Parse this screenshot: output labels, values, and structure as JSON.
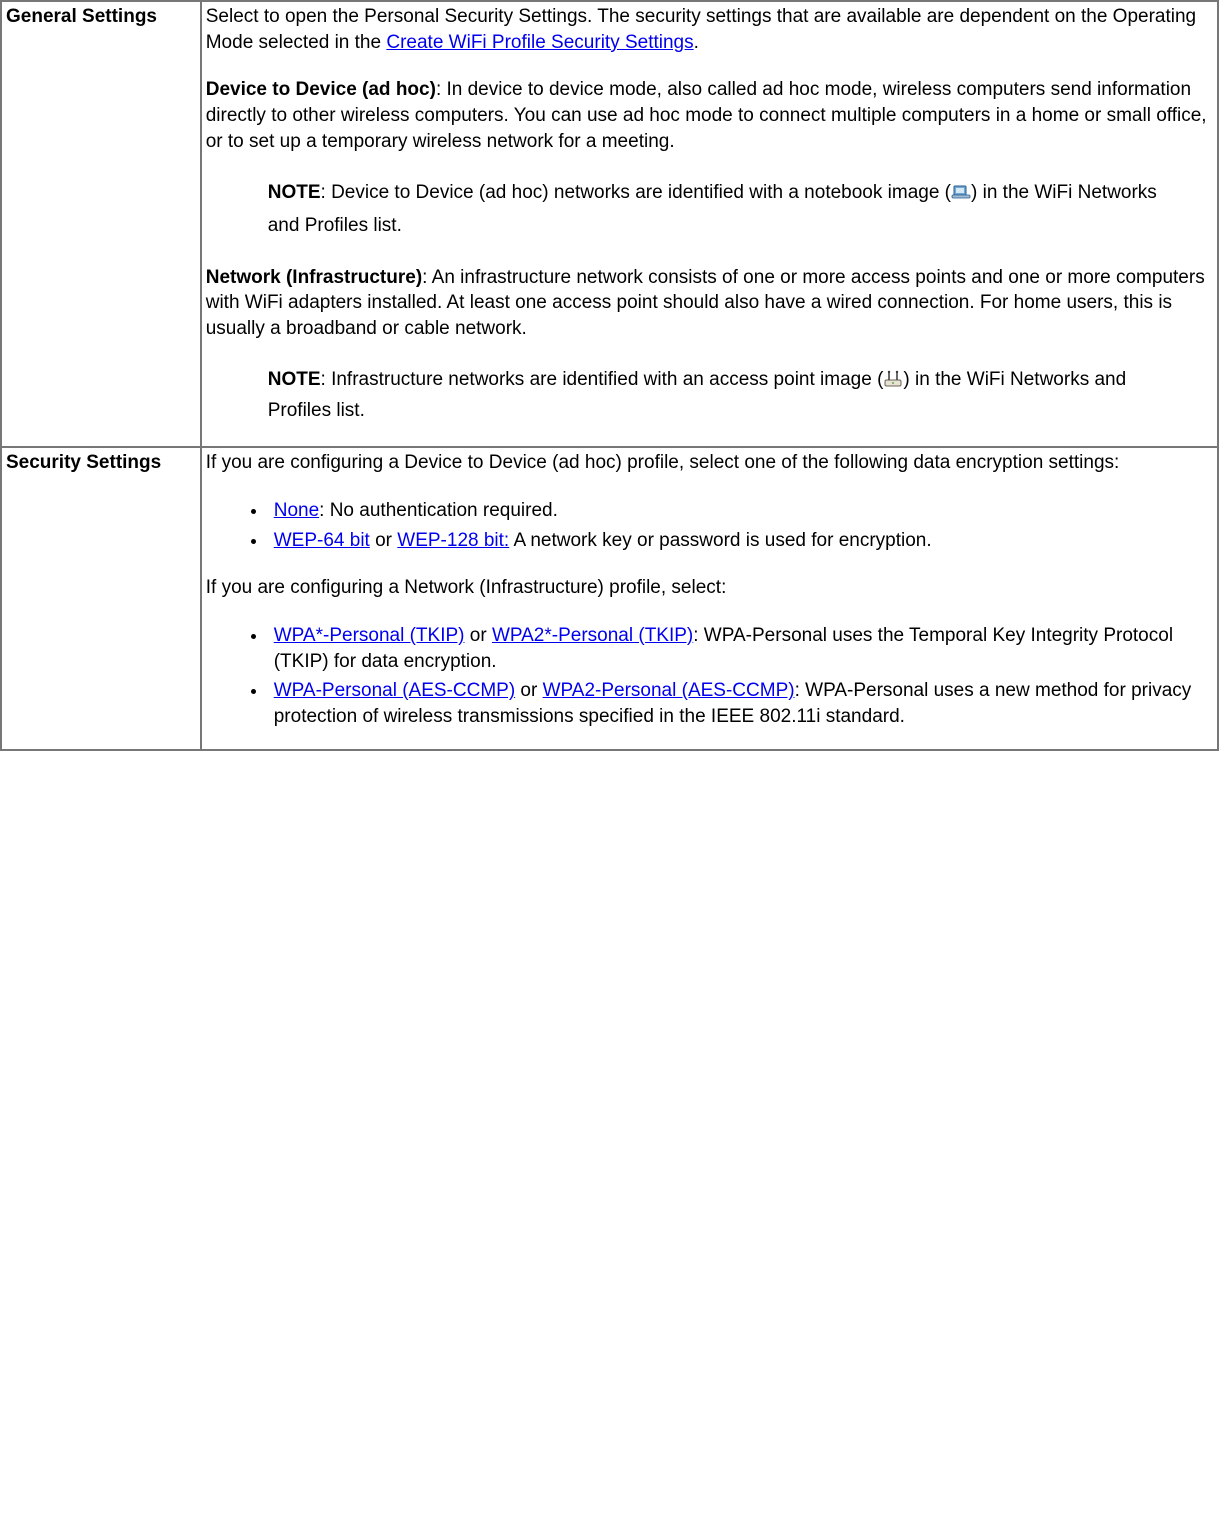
{
  "rows": {
    "general": {
      "label": "General Settings",
      "intro_pre": "Select to open the Personal Security Settings. The security settings that are available are dependent on the Operating Mode selected in the ",
      "intro_link": "Create WiFi Profile Security Settings",
      "intro_post": ".",
      "adhoc_heading": "Device to Device (ad hoc)",
      "adhoc_body": ": In device to device mode, also called ad hoc mode, wireless computers send information directly to other wireless computers. You can use ad hoc mode to connect multiple computers in a home or small office, or to set up a temporary wireless network for a meeting.",
      "adhoc_note_label": "NOTE",
      "adhoc_note_pre": ": Device to Device (ad hoc) networks are identified with a notebook image (",
      "adhoc_note_post": ") in the WiFi Networks and Profiles list.",
      "infra_heading": "Network (Infrastructure)",
      "infra_body": ": An infrastructure network consists of one or more access points and one or more computers with WiFi adapters installed. At least one access point should also have a wired connection. For home users, this is usually a broadband or cable network.",
      "infra_note_label": "NOTE",
      "infra_note_pre": ": Infrastructure networks are identified with an access point image (",
      "infra_note_post": ") in the WiFi Networks and Profiles list."
    },
    "security": {
      "label": "Security Settings",
      "adhoc_intro": "If you are configuring a Device to Device (ad hoc) profile, select one of the following data encryption settings:",
      "adhoc_list": {
        "item1": {
          "link_none": "None",
          "post_none": ": No authentication required."
        },
        "item2": {
          "link_wep64": "WEP-64 bit",
          "mid": " or ",
          "link_wep128": "WEP-128 bit:",
          "post": " A network key or password is used for encryption."
        }
      },
      "infra_intro": "If you are configuring a Network (Infrastructure) profile, select:",
      "infra_list": {
        "item1": {
          "link_wpa_tkip": "WPA*-Personal (TKIP)",
          "mid1": " or ",
          "link_wpa2_tkip": "WPA2*-Personal (TKIP)",
          "post1": ": WPA-Personal uses the Temporal Key Integrity Protocol (TKIP) for data encryption."
        },
        "item2": {
          "link_wpa_aes": "WPA-Personal (AES-CCMP)",
          "mid2": " or ",
          "link_wpa2_aes": "WPA2-Personal (AES-CCMP)",
          "post2": ": WPA-Personal uses a new method for privacy protection of wireless transmissions specified in the IEEE 802.11i standard."
        }
      }
    }
  }
}
